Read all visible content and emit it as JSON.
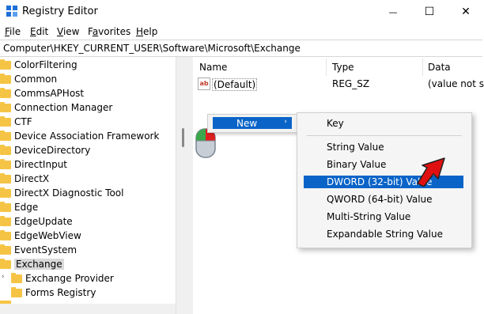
{
  "window": {
    "title": "Registry Editor",
    "minimize_glyph": "—",
    "maximize_glyph": "☐",
    "close_glyph": "✕"
  },
  "menu": [
    {
      "label": "File",
      "underline": "F",
      "rest": "ile"
    },
    {
      "label": "Edit",
      "underline": "E",
      "rest": "dit"
    },
    {
      "label": "View",
      "underline": "V",
      "rest": "iew"
    },
    {
      "label": "Favorites",
      "underline": "a",
      "pre": "F",
      "rest": "vorites"
    },
    {
      "label": "Help",
      "underline": "H",
      "rest": "elp"
    }
  ],
  "address": "Computer\\HKEY_CURRENT_USER\\Software\\Microsoft\\Exchange",
  "tree": {
    "items": [
      "ColorFiltering",
      "Common",
      "CommsAPHost",
      "Connection Manager",
      "CTF",
      "Device Association Framework",
      "DeviceDirectory",
      "DirectInput",
      "DirectX",
      "DirectX Diagnostic Tool",
      "Edge",
      "EdgeUpdate",
      "EdgeWebView",
      "EventSystem",
      "Exchange",
      "Exchange Provider",
      "Forms Registry"
    ],
    "selected": "Exchange",
    "expander_glyph": "›"
  },
  "columns": {
    "name": "Name",
    "type": "Type",
    "data": "Data"
  },
  "values": [
    {
      "icon": "ab",
      "name": "(Default)",
      "type": "REG_SZ",
      "data": "(value not set)"
    }
  ],
  "context_menu": {
    "new_label": "New",
    "new_arrow": "›",
    "submenu": {
      "key": "Key",
      "items": [
        "String Value",
        "Binary Value",
        "DWORD (32-bit) Value",
        "QWORD (64-bit) Value",
        "Multi-String Value",
        "Expandable String Value"
      ],
      "highlighted": "DWORD (32-bit) Value"
    }
  },
  "colors": {
    "highlight": "#0a64c8",
    "folder": "#f6c445",
    "annotation_arrow": "#e01010"
  },
  "icons": {
    "app": "registry-editor-icon",
    "folder": "folder-icon",
    "string_value": "string-value-icon",
    "mouse": "mouse-right-click-icon",
    "arrow": "red-arrow-annotation"
  }
}
